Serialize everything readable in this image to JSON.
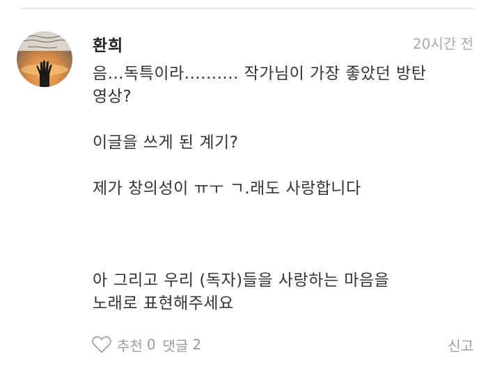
{
  "comment": {
    "author": "환희",
    "timestamp": "20시간 전",
    "body_lines": [
      "음...독특이라.......... 작가님이 가장 좋았던 방탄",
      "영상?",
      "",
      "이글을 쓰게 된 계기?",
      "",
      "제가 창의성이 ㅠㅜ ㄱ.래도 사랑합니다",
      "",
      "",
      "",
      "아 그리고 우리 (독자)들을 사랑하는 마음을",
      "노래로 표현해주세요"
    ],
    "avatar_icon": "avatar-hand-sunset-icon"
  },
  "footer": {
    "like_label": "추천",
    "like_count": "0",
    "reply_label": "댓글",
    "reply_count": "2",
    "report_label": "신고",
    "like_icon": "heart-outline-icon"
  },
  "colors": {
    "text_primary": "#333333",
    "text_muted": "#9a9a9a",
    "timestamp": "#a8a8a8",
    "divider": "#e4e4e4"
  }
}
